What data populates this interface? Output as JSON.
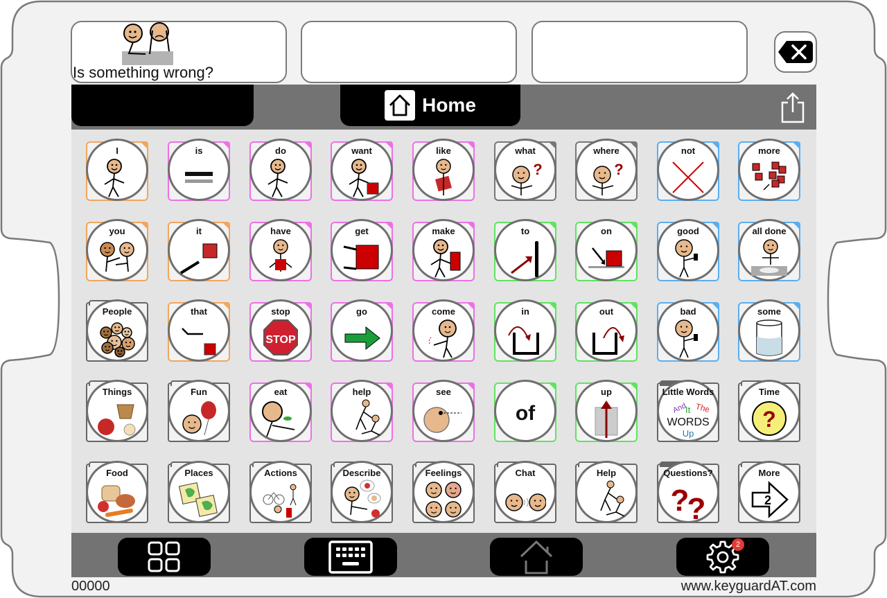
{
  "message_bar": {
    "slots": [
      {
        "text": "Is something wrong?",
        "symbol": "two-people-comfort-icon"
      },
      {
        "text": ""
      },
      {
        "text": ""
      }
    ],
    "clear_button": {
      "icon": "backspace-clear-icon"
    }
  },
  "tab_bar": {
    "active_tab": {
      "label": "Home",
      "icon": "home-icon"
    },
    "share_icon": "share-icon"
  },
  "colors": {
    "pronoun": "#f3a55c",
    "verb": "#ee6fe8",
    "question": "#777777",
    "descriptor": "#5aaef0",
    "preposition": "#5ee45e",
    "folder": "#666666",
    "grid_bg": "#e4e4e4",
    "bar_bg": "#737373"
  },
  "grid": {
    "rows": [
      [
        {
          "label": "I",
          "category": "pronoun",
          "icon": "person-pointing-self-icon"
        },
        {
          "label": "is",
          "category": "verb",
          "icon": "equals-icon"
        },
        {
          "label": "do",
          "category": "verb",
          "icon": "person-reaching-icon"
        },
        {
          "label": "want",
          "category": "verb",
          "icon": "person-reaching-box-icon"
        },
        {
          "label": "like",
          "category": "verb",
          "icon": "person-hugging-box-icon"
        },
        {
          "label": "what",
          "category": "question",
          "icon": "person-question-icon"
        },
        {
          "label": "where",
          "category": "question",
          "icon": "person-looking-question-icon"
        },
        {
          "label": "not",
          "category": "descriptor",
          "icon": "red-x-icon"
        },
        {
          "label": "more",
          "category": "descriptor",
          "icon": "many-blocks-icon"
        }
      ],
      [
        {
          "label": "you",
          "category": "pronoun",
          "icon": "two-people-pointing-icon"
        },
        {
          "label": "it",
          "category": "pronoun",
          "icon": "hand-pointing-box-icon"
        },
        {
          "label": "have",
          "category": "verb",
          "icon": "person-holding-box-icon"
        },
        {
          "label": "get",
          "category": "verb",
          "icon": "hands-grabbing-box-icon"
        },
        {
          "label": "make",
          "category": "verb",
          "icon": "person-hammering-icon"
        },
        {
          "label": "to",
          "category": "preposition",
          "icon": "arrow-to-line-icon"
        },
        {
          "label": "on",
          "category": "preposition",
          "icon": "arrow-on-box-icon"
        },
        {
          "label": "good",
          "category": "descriptor",
          "icon": "thumbs-up-person-icon"
        },
        {
          "label": "all done",
          "category": "descriptor",
          "icon": "all-done-hands-icon"
        }
      ],
      [
        {
          "label": "People",
          "category": "folder",
          "icon": "people-group-icon"
        },
        {
          "label": "that",
          "category": "pronoun",
          "icon": "hand-pointing-away-icon"
        },
        {
          "label": "stop",
          "category": "verb",
          "icon": "stop-sign-icon"
        },
        {
          "label": "go",
          "category": "verb",
          "icon": "green-arrow-icon"
        },
        {
          "label": "come",
          "category": "verb",
          "icon": "person-beckoning-icon"
        },
        {
          "label": "in",
          "category": "preposition",
          "icon": "arrow-into-container-icon"
        },
        {
          "label": "out",
          "category": "preposition",
          "icon": "arrow-out-container-icon"
        },
        {
          "label": "bad",
          "category": "descriptor",
          "icon": "thumbs-down-person-icon"
        },
        {
          "label": "some",
          "category": "descriptor",
          "icon": "glass-partial-icon"
        }
      ],
      [
        {
          "label": "Things",
          "category": "folder",
          "icon": "things-basket-ball-icon"
        },
        {
          "label": "Fun",
          "category": "folder",
          "icon": "face-balloon-icon"
        },
        {
          "label": "eat",
          "category": "verb",
          "icon": "person-eating-icon"
        },
        {
          "label": "help",
          "category": "verb",
          "icon": "person-helping-icon"
        },
        {
          "label": "see",
          "category": "verb",
          "icon": "face-eye-looking-icon"
        },
        {
          "label": "of",
          "category": "preposition",
          "icon": "",
          "big_text": "of"
        },
        {
          "label": "up",
          "category": "preposition",
          "icon": "arrow-up-icon"
        },
        {
          "label": "Little Words",
          "category": "folder-dark",
          "icon": "little-words-icon",
          "words": [
            "And",
            "It",
            "The",
            "WORDS",
            "Up"
          ]
        },
        {
          "label": "Time",
          "category": "folder",
          "icon": "clock-question-icon"
        }
      ],
      [
        {
          "label": "Food",
          "category": "folder",
          "icon": "food-icon"
        },
        {
          "label": "Places",
          "category": "folder",
          "icon": "maps-icon"
        },
        {
          "label": "Actions",
          "category": "folder",
          "icon": "actions-icon"
        },
        {
          "label": "Describe",
          "category": "folder",
          "icon": "describe-icon"
        },
        {
          "label": "Feelings",
          "category": "folder",
          "icon": "feelings-faces-icon"
        },
        {
          "label": "Chat",
          "category": "folder",
          "icon": "two-faces-chat-icon"
        },
        {
          "label": "Help",
          "category": "folder",
          "icon": "help-hands-icon"
        },
        {
          "label": "Questions?",
          "category": "folder-dark",
          "icon": "question-marks-icon"
        },
        {
          "label": "More",
          "category": "folder",
          "icon": "arrow-page-2-icon",
          "page": "2"
        }
      ]
    ]
  },
  "bottom_bar": {
    "buttons": [
      {
        "name": "grid-view",
        "icon": "grid-icon"
      },
      {
        "name": "keyboard",
        "icon": "keyboard-icon"
      },
      {
        "name": "home",
        "icon": "home-outline-icon"
      },
      {
        "name": "settings",
        "icon": "gear-icon",
        "badge": "2"
      }
    ]
  },
  "footer": {
    "counter": "00000",
    "url": "www.keyguardAT.com"
  }
}
